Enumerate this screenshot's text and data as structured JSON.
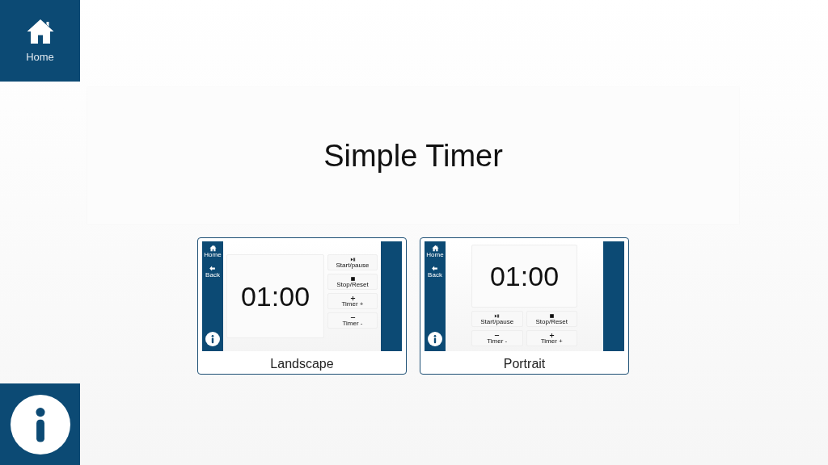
{
  "sidebar": {
    "home": {
      "label": "Home"
    }
  },
  "title": "Simple Timer",
  "layouts": [
    {
      "kind": "landscape",
      "label": "Landscape",
      "preview": {
        "nav": [
          {
            "kind": "home",
            "label": "Home"
          },
          {
            "kind": "back",
            "label": "Back"
          }
        ],
        "time": "01:00",
        "buttons": [
          {
            "kind": "play-pause",
            "label": "Start/pause"
          },
          {
            "kind": "stop",
            "label": "Stop/Reset"
          },
          {
            "kind": "plus",
            "label": "Timer +"
          },
          {
            "kind": "minus",
            "label": "Timer -"
          }
        ]
      }
    },
    {
      "kind": "portrait",
      "label": "Portrait",
      "preview": {
        "nav": [
          {
            "kind": "home",
            "label": "Home"
          },
          {
            "kind": "back",
            "label": "Back"
          }
        ],
        "time": "01:00",
        "buttons": [
          {
            "kind": "play-pause",
            "label": "Start/pause"
          },
          {
            "kind": "stop",
            "label": "Stop/Reset"
          },
          {
            "kind": "minus",
            "label": "Timer -"
          },
          {
            "kind": "plus",
            "label": "Timer +"
          }
        ]
      }
    }
  ]
}
